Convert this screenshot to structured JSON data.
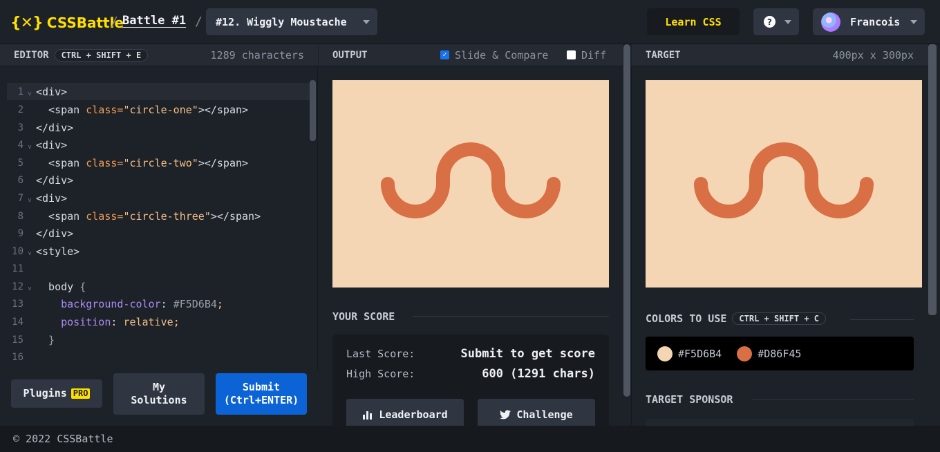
{
  "header": {
    "logo_text": "CSSBattle",
    "battle_link": "Battle #1",
    "target_select": "#12. Wiggly Moustache",
    "learn_css": "Learn CSS",
    "help_glyph": "?",
    "user_name": "Francois"
  },
  "editor": {
    "title": "EDITOR",
    "shortcut": "CTRL + SHIFT + E",
    "char_count": "1289 characters",
    "lines": [
      {
        "n": "1",
        "fold": true
      },
      {
        "n": "2",
        "fold": false
      },
      {
        "n": "3",
        "fold": false
      },
      {
        "n": "4",
        "fold": true
      },
      {
        "n": "5",
        "fold": false
      },
      {
        "n": "6",
        "fold": false
      },
      {
        "n": "7",
        "fold": true
      },
      {
        "n": "8",
        "fold": false
      },
      {
        "n": "9",
        "fold": false
      },
      {
        "n": "10",
        "fold": true
      },
      {
        "n": "11",
        "fold": false
      },
      {
        "n": "12",
        "fold": true
      },
      {
        "n": "13",
        "fold": false
      },
      {
        "n": "14",
        "fold": false
      },
      {
        "n": "15",
        "fold": false
      },
      {
        "n": "16",
        "fold": false
      }
    ],
    "code": {
      "l1": "<div>",
      "l2_a": "  <span ",
      "l2_b": "class=",
      "l2_c": "\"circle-one\"",
      "l2_d": "></span>",
      "l3": "</div>",
      "l4": "<div>",
      "l5_a": "  <span ",
      "l5_b": "class=",
      "l5_c": "\"circle-two\"",
      "l5_d": "></span>",
      "l6": "</div>",
      "l7": "<div>",
      "l8_a": "  <span ",
      "l8_b": "class=",
      "l8_c": "\"circle-three\"",
      "l8_d": "></span>",
      "l9": "</div>",
      "l10": "<style>",
      "l12_a": "  body ",
      "l12_b": "{",
      "l13_a": "    background-color",
      "l13_b": ": ",
      "l13_c": "#F5D6B4",
      "l13_d": ";",
      "l14_a": "    position",
      "l14_b": ": ",
      "l14_c": "relative",
      "l14_d": ";",
      "l15": "  }"
    },
    "plugins_label": "Plugins",
    "pro_badge": "PRO",
    "my_solutions_line1": "My",
    "my_solutions_line2": "Solutions",
    "submit_line1": "Submit",
    "submit_line2": "(Ctrl+ENTER)"
  },
  "output": {
    "title": "OUTPUT",
    "slide_compare": "Slide & Compare",
    "slide_compare_checked": true,
    "diff": "Diff",
    "diff_checked": false
  },
  "score": {
    "title": "YOUR SCORE",
    "last_label": "Last Score:",
    "last_value": "Submit to get score",
    "high_label": "High Score:",
    "high_value": "600 (1291 chars)",
    "leaderboard": "Leaderboard",
    "challenge": "Challenge"
  },
  "target": {
    "title": "TARGET",
    "size": "400px x 300px",
    "colors_title": "COLORS TO USE",
    "colors_shortcut": "CTRL + SHIFT + C",
    "colors": [
      "#F5D6B4",
      "#D86F45"
    ],
    "sponsor_title": "TARGET SPONSOR"
  },
  "footer": {
    "copyright": "© 2022 CSSBattle"
  },
  "theme": {
    "accent_yellow": "#ffdf00",
    "submit_blue": "#0b63d6",
    "bg_color": "#F5D6B4",
    "fg_color": "#D86F45"
  }
}
